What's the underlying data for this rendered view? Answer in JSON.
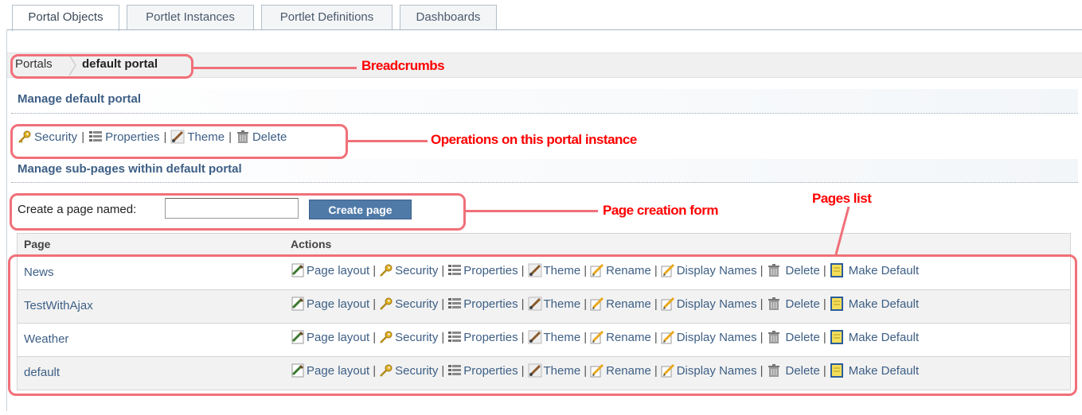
{
  "tabs": [
    {
      "label": "Portal Objects",
      "active": true
    },
    {
      "label": "Portlet Instances",
      "active": false
    },
    {
      "label": "Portlet Definitions",
      "active": false
    },
    {
      "label": "Dashboards",
      "active": false
    }
  ],
  "breadcrumb": {
    "parent": "Portals",
    "current": "default portal"
  },
  "manage_title": "Manage default portal",
  "portal_ops": [
    "Security",
    "Properties",
    "Theme",
    "Delete"
  ],
  "subpages_title": "Manage sub-pages within default portal",
  "create_form": {
    "label": "Create a page named:",
    "input_value": "",
    "button_label": "Create page"
  },
  "table": {
    "headers": [
      "Page",
      "Actions"
    ],
    "actions": [
      "Page layout",
      "Security",
      "Properties",
      "Theme",
      "Rename",
      "Display Names",
      "Delete",
      "Make Default"
    ],
    "rows": [
      "News",
      "TestWithAjax",
      "Weather",
      "default"
    ]
  },
  "annotations": {
    "breadcrumbs": "Breadcrumbs",
    "operations": "Operations on this portal instance",
    "page_form": "Page creation form",
    "pages_list": "Pages list"
  },
  "colors": {
    "link": "#3d5f85",
    "annotation": "#ff0000",
    "callout_border": "#f07079",
    "button": "#4f7aa8"
  }
}
